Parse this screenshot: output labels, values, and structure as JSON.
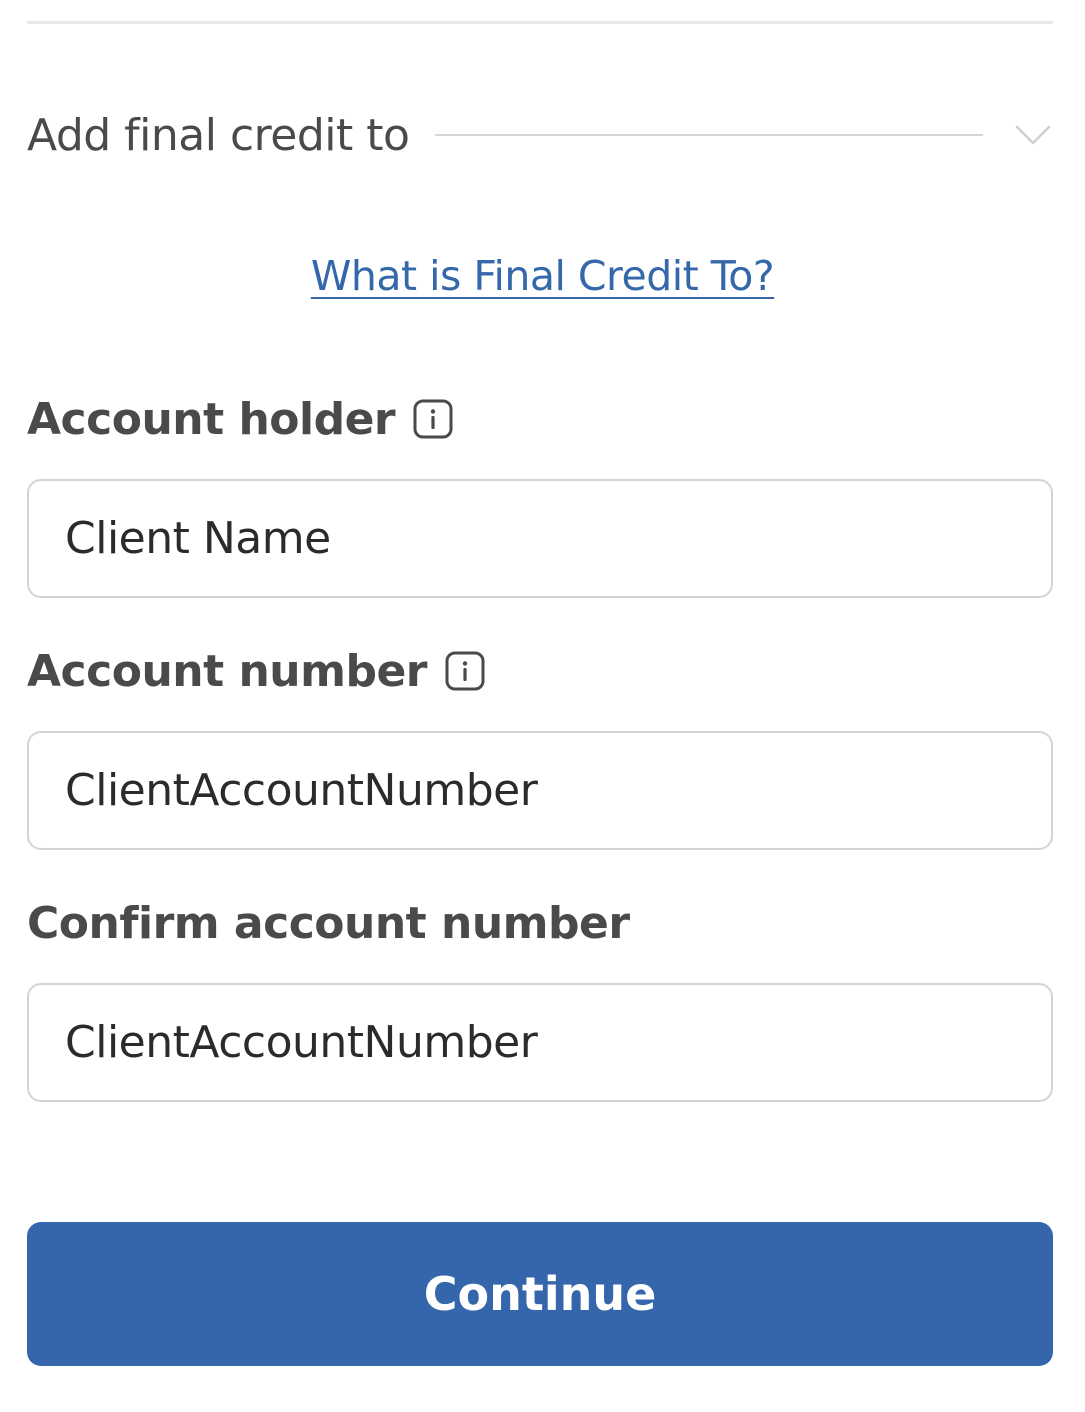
{
  "final_credit": {
    "label": "Add final credit to",
    "link_text": "What is Final Credit To?"
  },
  "account_holder": {
    "label": "Account holder",
    "value": "Client Name"
  },
  "account_number": {
    "label": "Account number",
    "value": "ClientAccountNumber"
  },
  "confirm_account_number": {
    "label": "Confirm account number",
    "value": "ClientAccountNumber"
  },
  "continue_button": {
    "label": "Continue"
  },
  "icons": {
    "dropdown": "chevron-down-icon",
    "info": "info-icon"
  },
  "colors": {
    "primary": "#3566ab",
    "link": "#3567ab",
    "label_text": "#4a4a4a",
    "input_border": "#d4d4d4"
  }
}
